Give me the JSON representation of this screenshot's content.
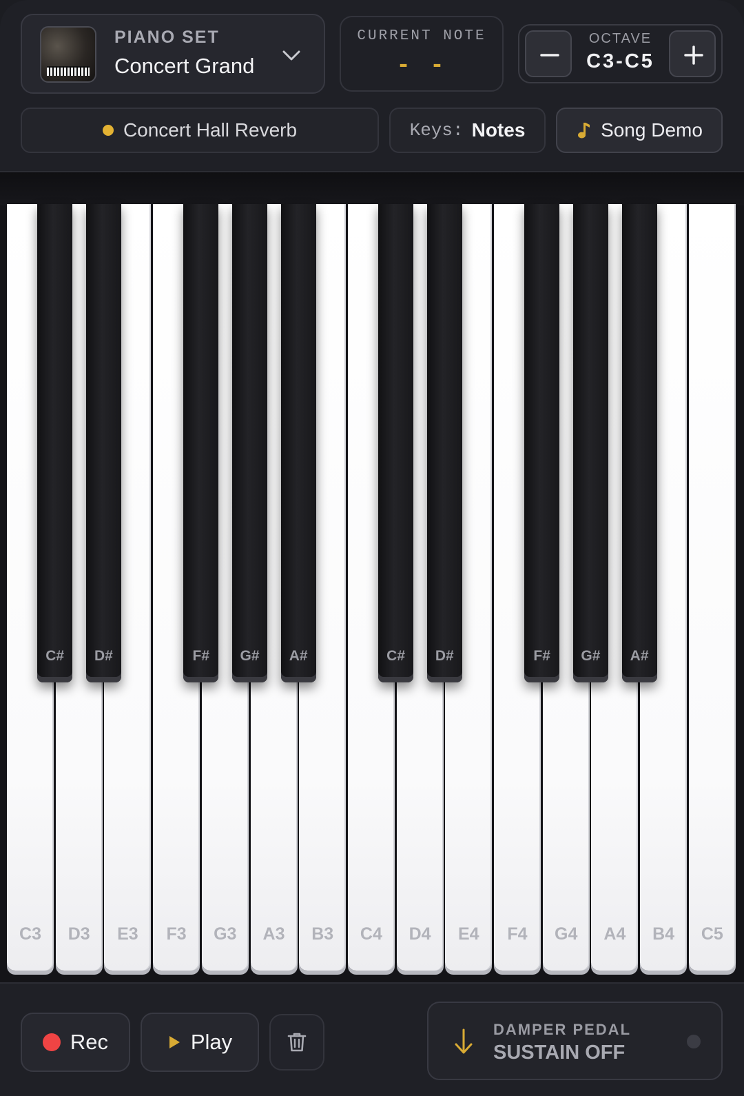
{
  "piano_set": {
    "label": "PIANO SET",
    "value": "Concert Grand"
  },
  "current_note": {
    "label": "CURRENT NOTE",
    "value": "- -"
  },
  "octave": {
    "label": "OCTAVE",
    "value": "C3-C5"
  },
  "reverb": {
    "label": "Concert Hall Reverb"
  },
  "keys_toggle": {
    "label": "Keys:",
    "value": "Notes"
  },
  "song_demo": {
    "label": "Song Demo"
  },
  "white_keys": [
    "C3",
    "D3",
    "E3",
    "F3",
    "G3",
    "A3",
    "B3",
    "C4",
    "D4",
    "E4",
    "F4",
    "G4",
    "A4",
    "B4",
    "C5"
  ],
  "black_keys": [
    "C#",
    "D#",
    "F#",
    "G#",
    "A#",
    "C#",
    "D#",
    "F#",
    "G#",
    "A#"
  ],
  "transport": {
    "rec": "Rec",
    "play": "Play"
  },
  "damper_pedal": {
    "label": "DAMPER PEDAL",
    "value": "SUSTAIN OFF"
  },
  "colors": {
    "accent": "#d9ab34",
    "record": "#ef4444",
    "background": "#1c1d22"
  },
  "icons": [
    "piano-thumbnail",
    "chevron-down-icon",
    "minus-icon",
    "plus-icon",
    "music-note-icon",
    "record-icon",
    "play-icon",
    "trash-icon",
    "arrow-down-icon"
  ]
}
